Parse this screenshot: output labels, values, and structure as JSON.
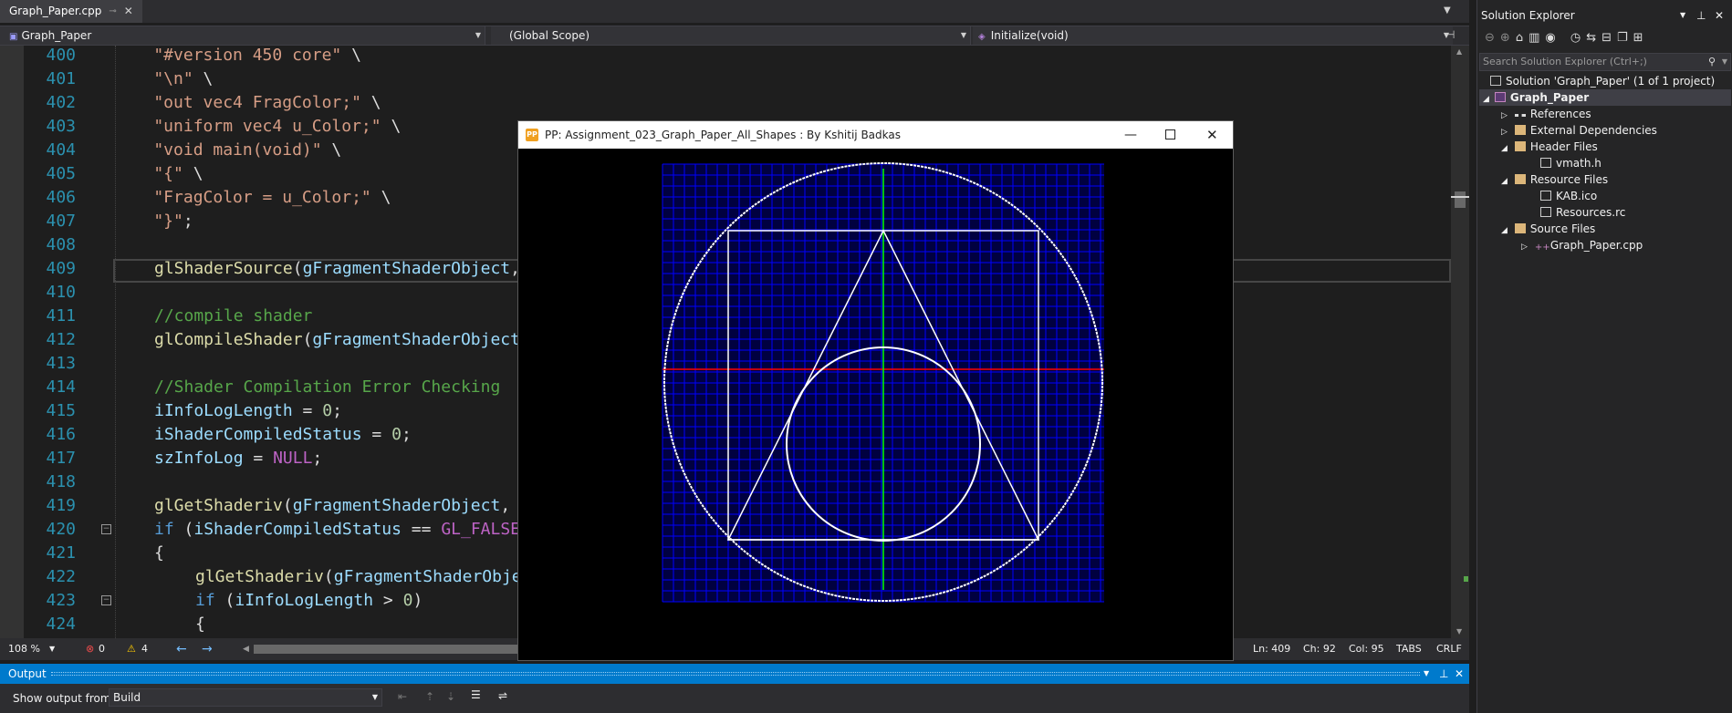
{
  "colors": {
    "accent": "#007acc",
    "grid_blue": "#0000ff",
    "axis_red": "#ff0000",
    "axis_green": "#00ff00",
    "shape_white": "#ffffff"
  },
  "tab": {
    "filename": "Graph_Paper.cpp",
    "pin_icon": "pin-icon",
    "close_icon": "close-icon"
  },
  "nav": {
    "project": "Graph_Paper",
    "scope": "(Global Scope)",
    "member": "Initialize(void)"
  },
  "editor": {
    "lines": [
      {
        "num": "400"
      },
      {
        "num": "401"
      },
      {
        "num": "402"
      },
      {
        "num": "403"
      },
      {
        "num": "404"
      },
      {
        "num": "405"
      },
      {
        "num": "406"
      },
      {
        "num": "407"
      },
      {
        "num": "408"
      },
      {
        "num": "409"
      },
      {
        "num": "410"
      },
      {
        "num": "411"
      },
      {
        "num": "412"
      },
      {
        "num": "413"
      },
      {
        "num": "414"
      },
      {
        "num": "415"
      },
      {
        "num": "416"
      },
      {
        "num": "417"
      },
      {
        "num": "418"
      },
      {
        "num": "419"
      },
      {
        "num": "420"
      },
      {
        "num": "421"
      },
      {
        "num": "422"
      },
      {
        "num": "423"
      },
      {
        "num": "424"
      }
    ]
  },
  "status": {
    "zoom": "108 %",
    "errors": "0",
    "warnings": "4",
    "ln": "Ln: 409",
    "ch": "Ch: 92",
    "col": "Col: 95",
    "tabs": "TABS",
    "eol": "CRLF"
  },
  "output": {
    "title": "Output",
    "show_from_label": "Show output from:",
    "source": "Build"
  },
  "solution_explorer": {
    "title": "Solution Explorer",
    "search_placeholder": "Search Solution Explorer (Ctrl+;)",
    "items": {
      "solution": "Solution 'Graph_Paper' (1 of 1 project)",
      "project": "Graph_Paper",
      "references": "References",
      "external": "External Dependencies",
      "header": "Header Files",
      "vmath": "vmath.h",
      "resource": "Resource Files",
      "kab": "KAB.ico",
      "resources_rc": "Resources.rc",
      "source": "Source Files",
      "cpp": "Graph_Paper.cpp"
    }
  },
  "app_window": {
    "title": "PP: Assignment_023_Graph_Paper_All_Shapes : By Kshitij Badkas",
    "icon": "app-icon"
  }
}
